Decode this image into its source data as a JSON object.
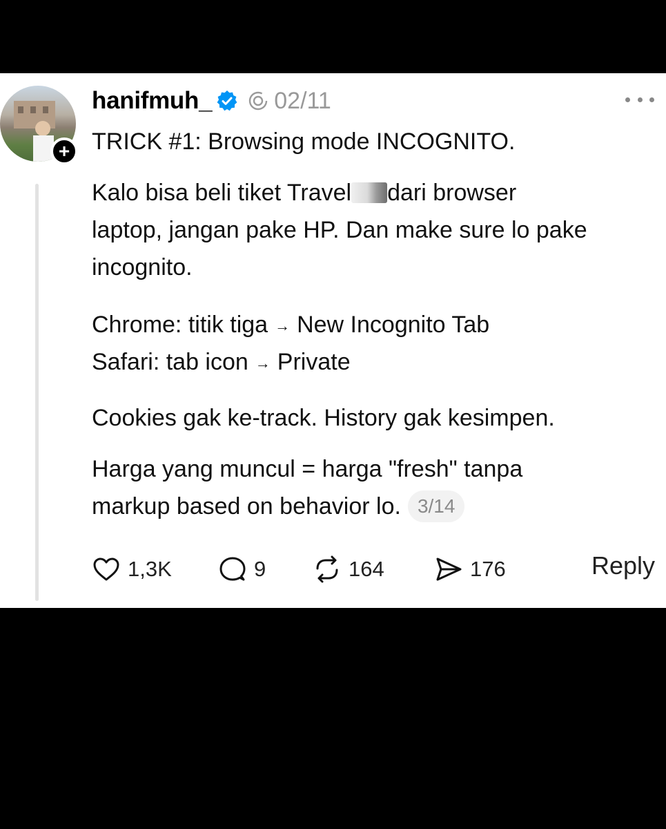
{
  "post": {
    "username": "hanifmuh_",
    "date": "02/11",
    "lines": [
      "TRICK #1: Browsing mode INCOGNITO.",
      "Kalo bisa beli tiket Travel",
      "dari browser",
      "laptop, jangan pake HP. Dan make sure lo pake",
      "incognito.",
      "Chrome: titik tiga",
      "New Incognito Tab",
      "Safari: tab icon",
      "Private",
      "Cookies gak ke-track. History gak kesimpen.",
      "Harga yang muncul = harga \"fresh\" tanpa",
      "markup based on behavior lo."
    ],
    "arrow": "→",
    "thread_position": "3/14"
  },
  "actions": {
    "likes": "1,3K",
    "comments": "9",
    "reposts": "164",
    "shares": "176",
    "reply_label": "Reply"
  },
  "icons": [
    "verified-badge-icon",
    "thread-icon",
    "more-icon",
    "heart-icon",
    "comment-icon",
    "repost-icon",
    "share-icon",
    "plus-icon"
  ],
  "colors": {
    "verified": "#0095f6",
    "text": "#111111",
    "muted": "#999999"
  }
}
